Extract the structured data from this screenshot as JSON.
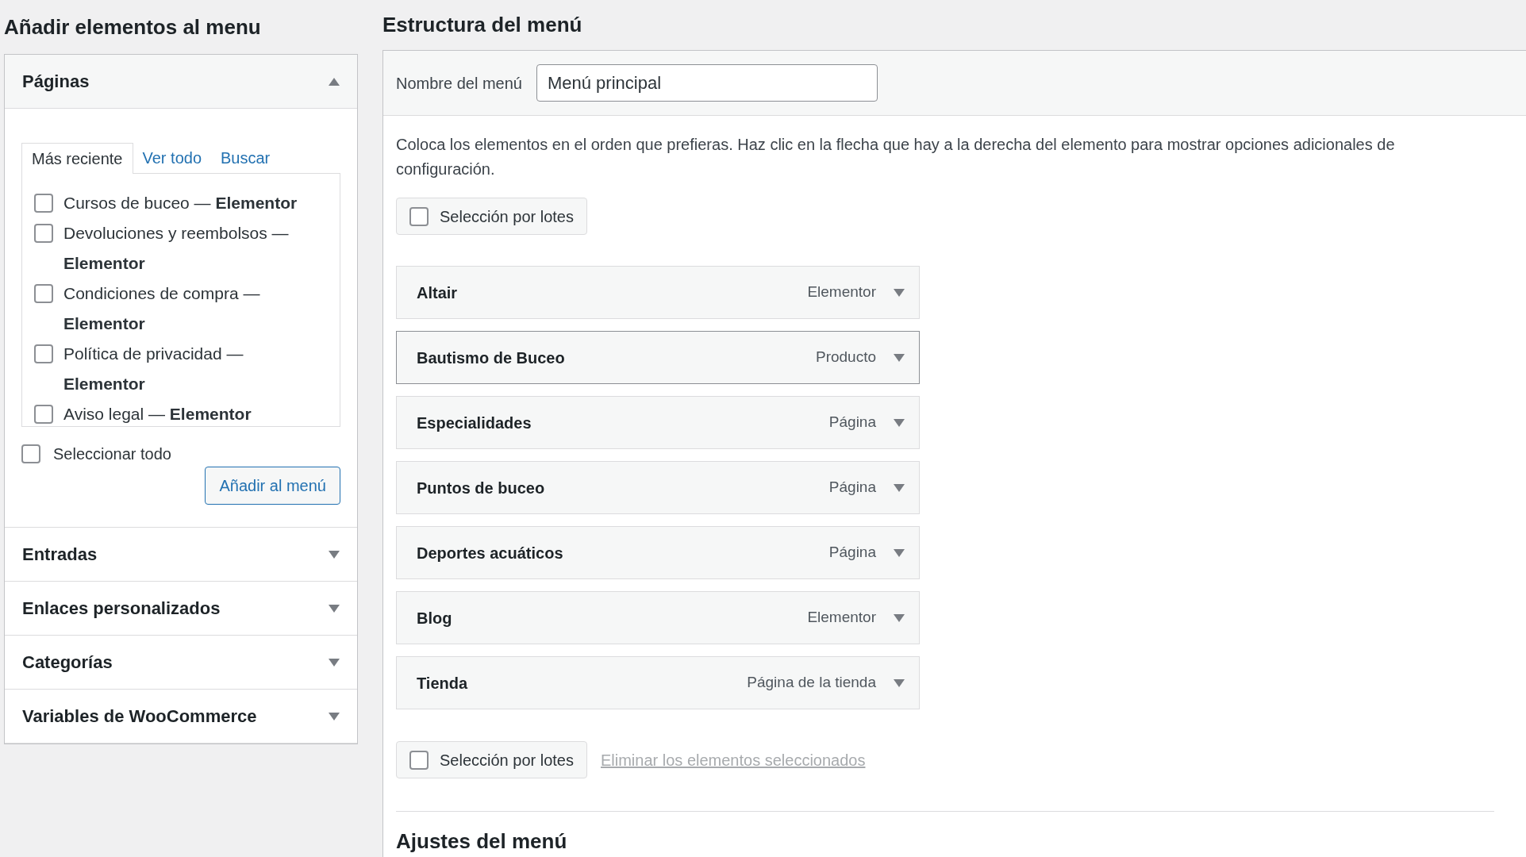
{
  "add_items": {
    "title": "Añadir elementos al menu",
    "sections": [
      {
        "title": "Páginas",
        "expanded": true,
        "tabs": [
          {
            "label": "Más reciente",
            "selected": true
          },
          {
            "label": "Ver todo",
            "selected": false
          },
          {
            "label": "Buscar",
            "selected": false
          }
        ],
        "items": [
          {
            "label": "Cursos de buceo — **Elementor**",
            "checked": false
          },
          {
            "label": "Devoluciones y reembolsos — **Elementor**",
            "checked": false
          },
          {
            "label": "Condiciones de compra — **Elementor**",
            "checked": false
          },
          {
            "label": "Política de privacidad — **Elementor**",
            "checked": false
          },
          {
            "label": "Aviso legal — **Elementor**",
            "checked": false
          }
        ],
        "select_all": {
          "label": "Seleccionar todo",
          "checked": false
        },
        "button": "Añadir al menú"
      },
      {
        "title": "Entradas",
        "expanded": false
      },
      {
        "title": "Enlaces personalizados",
        "expanded": false
      },
      {
        "title": "Categorías",
        "expanded": false
      },
      {
        "title": "Variables de WooCommerce",
        "expanded": false
      }
    ]
  },
  "structure": {
    "title": "Estructura del menú",
    "name_label": "Nombre del menú",
    "name_value": "Menú principal",
    "instructions": "Coloca los elementos en el orden que prefieras. Haz clic en la flecha que hay a la derecha del elemento para mostrar opciones adicionales de configuración.",
    "bulk_top": {
      "label": "Selección por lotes",
      "checked": false
    },
    "items": [
      {
        "title": "Altair",
        "type": "Elementor",
        "highlighted": false
      },
      {
        "title": "Bautismo de Buceo",
        "type": "Producto",
        "highlighted": true
      },
      {
        "title": "Especialidades",
        "type": "Página",
        "highlighted": false
      },
      {
        "title": "Puntos de buceo",
        "type": "Página",
        "highlighted": false
      },
      {
        "title": "Deportes acuáticos",
        "type": "Página",
        "highlighted": false
      },
      {
        "title": "Blog",
        "type": "Elementor",
        "highlighted": false
      },
      {
        "title": "Tienda",
        "type": "Página de la tienda",
        "highlighted": false
      }
    ],
    "bulk_bottom": {
      "label": "Selección por lotes",
      "checked": false
    },
    "delete_link": "Eliminar los elementos seleccionados",
    "settings_title": "Ajustes del menú"
  }
}
